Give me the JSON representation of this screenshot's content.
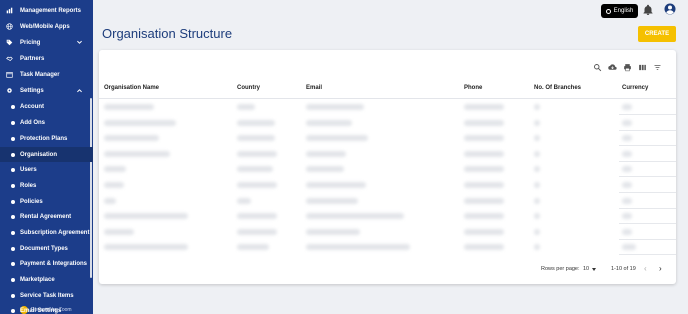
{
  "sidebar": {
    "items": [
      {
        "label": "Management Reports",
        "icon": "chart-icon",
        "type": "top"
      },
      {
        "label": "Web/Mobile Apps",
        "icon": "globe-icon",
        "type": "top"
      },
      {
        "label": "Pricing",
        "icon": "tag-icon",
        "type": "top",
        "chevron": "down"
      },
      {
        "label": "Partners",
        "icon": "handshake-icon",
        "type": "top"
      },
      {
        "label": "Task Manager",
        "icon": "calendar-icon",
        "type": "top"
      },
      {
        "label": "Settings",
        "icon": "gear-icon",
        "type": "top",
        "chevron": "up"
      },
      {
        "label": "Account",
        "type": "sub"
      },
      {
        "label": "Add Ons",
        "type": "sub"
      },
      {
        "label": "Protection Plans",
        "type": "sub"
      },
      {
        "label": "Organisation",
        "type": "sub",
        "active": true
      },
      {
        "label": "Users",
        "type": "sub"
      },
      {
        "label": "Roles",
        "type": "sub"
      },
      {
        "label": "Policies",
        "type": "sub"
      },
      {
        "label": "Rental Agreement",
        "type": "sub"
      },
      {
        "label": "Subscription Agreement",
        "type": "sub"
      },
      {
        "label": "Document Types",
        "type": "sub"
      },
      {
        "label": "Payment & Integrations",
        "type": "sub"
      },
      {
        "label": "Marketplace",
        "type": "sub"
      },
      {
        "label": "Service Task Items",
        "type": "sub"
      },
      {
        "label": "Email Settings",
        "type": "sub"
      }
    ],
    "logo_text": "Powered by Zoom"
  },
  "topbar": {
    "language": "English"
  },
  "page": {
    "title": "Organisation Structure",
    "create_label": "CREATE"
  },
  "table": {
    "columns": [
      "Organisation Name",
      "Country",
      "Email",
      "Phone",
      "No. Of Branches",
      "Currency"
    ]
  },
  "pagination": {
    "rows_per_page_label": "Rows per page:",
    "rows_per_page_value": "10",
    "range": "1-10 of 19"
  },
  "colors": {
    "sidebar": "#1c3d8a",
    "accent": "#f5c000",
    "title": "#1d3d7c"
  }
}
